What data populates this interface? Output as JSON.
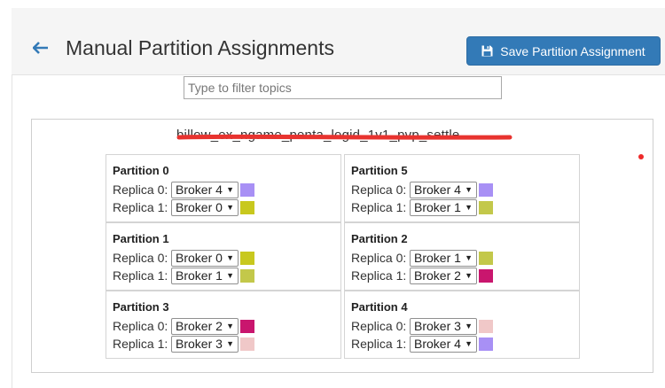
{
  "header": {
    "title": "Manual Partition Assignments",
    "save_label": "Save Partition Assignment"
  },
  "filter": {
    "placeholder": "Type to filter topics",
    "value": ""
  },
  "topic": {
    "name": "billow_ex_ngame_penta_logid_1v1_pvp_settle"
  },
  "brokers": {
    "Broker 0": "#c8c81e",
    "Broker 1": "#c3c84a",
    "Broker 2": "#c9166e",
    "Broker 3": "#f0c8c8",
    "Broker 4": "#a890f5"
  },
  "partitions": [
    {
      "title": "Partition 0",
      "replicas": [
        {
          "label": "Replica 0:",
          "broker": "Broker 4"
        },
        {
          "label": "Replica 1:",
          "broker": "Broker 0"
        }
      ]
    },
    {
      "title": "Partition 5",
      "replicas": [
        {
          "label": "Replica 0:",
          "broker": "Broker 4"
        },
        {
          "label": "Replica 1:",
          "broker": "Broker 1"
        }
      ]
    },
    {
      "title": "Partition 1",
      "replicas": [
        {
          "label": "Replica 0:",
          "broker": "Broker 0"
        },
        {
          "label": "Replica 1:",
          "broker": "Broker 1"
        }
      ]
    },
    {
      "title": "Partition 2",
      "replicas": [
        {
          "label": "Replica 0:",
          "broker": "Broker 1"
        },
        {
          "label": "Replica 1:",
          "broker": "Broker 2"
        }
      ]
    },
    {
      "title": "Partition 3",
      "replicas": [
        {
          "label": "Replica 0:",
          "broker": "Broker 2"
        },
        {
          "label": "Replica 1:",
          "broker": "Broker 3"
        }
      ]
    },
    {
      "title": "Partition 4",
      "replicas": [
        {
          "label": "Replica 0:",
          "broker": "Broker 3"
        },
        {
          "label": "Replica 1:",
          "broker": "Broker 4"
        }
      ]
    }
  ],
  "icons": {
    "back": "arrow-left-icon",
    "save": "floppy-disk-icon",
    "dropdown": "caret-down-icon"
  },
  "colors": {
    "primary": "#337ab7",
    "strike": "#e8332f",
    "red_dot": "#ee2a2a"
  }
}
